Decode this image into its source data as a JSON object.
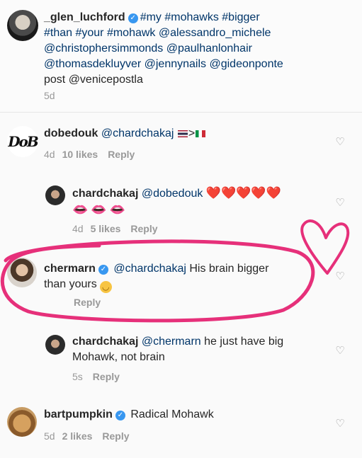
{
  "caption": {
    "username": "_glen_luchford",
    "tags": [
      "#my",
      "#mohawks",
      "#bigger",
      "#than",
      "#your",
      "#mohawk"
    ],
    "line1_tags": "#my #mohawks #bigger",
    "line2": "#than #your #mohawk @alessandro_michele",
    "line3": "@christophersimmonds @paulhanlonhair",
    "line4": "@thomasdekluyver @jennynails @gideonponte",
    "line5": "post @venicepostla",
    "time": "5d"
  },
  "comments": [
    {
      "username": "dobedouk",
      "avatar_text": "DoB",
      "mention": "@chardchakaj",
      "tail": ">",
      "time": "4d",
      "likes": "10 likes",
      "reply": "Reply"
    },
    {
      "username": "chardchakaj",
      "mention": "@dobedouk",
      "hearts": "❤️❤️❤️❤️❤️",
      "lips": "👄👄👄",
      "time": "4d",
      "likes": "5 likes",
      "reply": "Reply"
    },
    {
      "username": "chermarn",
      "mention": "@chardchakaj",
      "text_a": "His brain bigger",
      "text_b": "than yours",
      "reply": "Reply"
    },
    {
      "username": "chardchakaj",
      "mention": "@chermarn",
      "text_a": "he just have big",
      "text_b": "Mohawk, not brain",
      "time": "5s",
      "reply": "Reply"
    },
    {
      "username": "bartpumpkin",
      "text": "Radical Mohawk",
      "time": "5d",
      "likes": "2 likes",
      "reply": "Reply"
    }
  ],
  "icons": {
    "like": "heart-outline-icon",
    "verified": "verified-badge-icon"
  },
  "colors": {
    "annotation": "#e6307a",
    "verified": "#3897f0",
    "mention": "#003569",
    "muted": "#999999"
  }
}
